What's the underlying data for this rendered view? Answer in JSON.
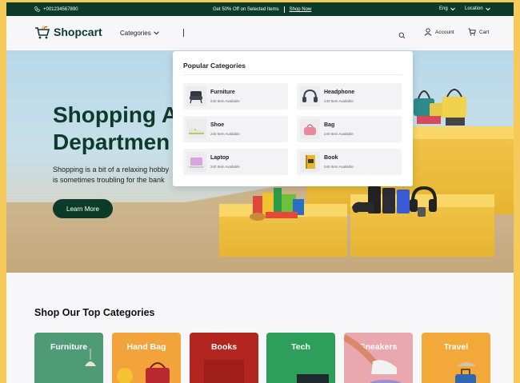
{
  "topbar": {
    "phone": "+001234567890",
    "promo": "Get 50% Off on Selected Items",
    "shop_now": "Shop Now",
    "language": "Eng",
    "location": "Location"
  },
  "header": {
    "logo": "Shopcart",
    "categories": "Categories",
    "account": "Account",
    "cart": "Cart"
  },
  "hero": {
    "headline_line1": "Shopping A",
    "headline_line2": "Departmen",
    "desc_line1": "Shopping is a bit of a relaxing hobby",
    "desc_line2": "is sometimes troubling for the bank",
    "cta": "Learn More"
  },
  "dropdown": {
    "title": "Popular Categories",
    "items": [
      {
        "name": "Furniture",
        "available": "240 Item Available",
        "icon": "chair-icon"
      },
      {
        "name": "Headphone",
        "available": "240 Item Available",
        "icon": "headphone-icon"
      },
      {
        "name": "Shoe",
        "available": "240 Item Available",
        "icon": "shoe-icon"
      },
      {
        "name": "Bag",
        "available": "240 Item Available",
        "icon": "bag-icon"
      },
      {
        "name": "Laptop",
        "available": "240 Item Available",
        "icon": "laptop-icon"
      },
      {
        "name": "Book",
        "available": "240 Item Available",
        "icon": "book-icon"
      }
    ]
  },
  "top_categories": {
    "title": "Shop Our Top Categories",
    "tiles": [
      {
        "label": "Furniture",
        "color": "#4f9a77"
      },
      {
        "label": "Hand Bag",
        "color": "#f2a33c"
      },
      {
        "label": "Books",
        "color": "#b3251f"
      },
      {
        "label": "Tech",
        "color": "#2e9e5b"
      },
      {
        "label": "Sneakers",
        "color": "#e9a7b0"
      },
      {
        "label": "Travel",
        "color": "#f3a93a"
      }
    ]
  },
  "colors": {
    "brand": "#0d3b2a",
    "accent": "#f1c64a"
  }
}
